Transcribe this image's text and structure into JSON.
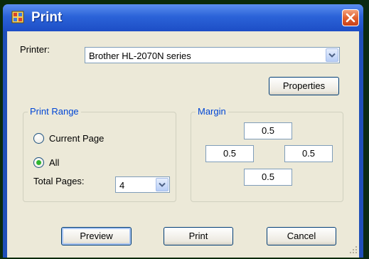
{
  "window": {
    "title": "Print"
  },
  "printer": {
    "label": "Printer:",
    "selected": "Brother HL-2070N series"
  },
  "properties_button": "Properties",
  "print_range": {
    "title": "Print Range",
    "current_page_label": "Current Page",
    "all_label": "All",
    "selected": "All",
    "total_pages_label": "Total Pages:",
    "total_pages_value": "4"
  },
  "margin": {
    "title": "Margin",
    "top": "0.5",
    "left": "0.5",
    "right": "0.5",
    "bottom": "0.5"
  },
  "buttons": {
    "preview": "Preview",
    "print": "Print",
    "cancel": "Cancel"
  },
  "colors": {
    "title_bar": "#2b63d8",
    "close_button": "#e2612f",
    "dialog_bg": "#ece9d8",
    "group_title": "#0046d5"
  },
  "icons": {
    "app": "print-dialog-icon",
    "close": "close-icon",
    "dropdown": "chevron-down-icon",
    "resize": "resize-grip-icon"
  }
}
